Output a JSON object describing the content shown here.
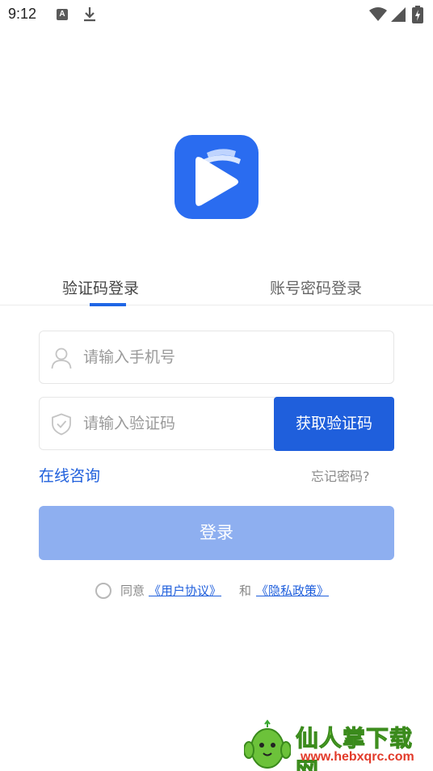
{
  "status_bar": {
    "time": "9:12",
    "notification_letter": "A"
  },
  "app": {
    "logo_icon": "play-logo-icon",
    "brand_color": "#2a6cf0"
  },
  "tabs": [
    {
      "label": "验证码登录",
      "active": true
    },
    {
      "label": "账号密码登录",
      "active": false
    }
  ],
  "form": {
    "phone_placeholder": "请输入手机号",
    "code_placeholder": "请输入验证码",
    "get_code_label": "获取验证码",
    "consult_label": "在线咨询",
    "forgot_label": "忘记密码?",
    "login_label": "登录"
  },
  "agreement": {
    "prefix": "同意",
    "user_agreement": "《用户协议》",
    "and": "和",
    "privacy_policy": "《隐私政策》",
    "checked": false
  },
  "watermark": {
    "title": "仙人掌下载网",
    "url": "www.hebxqrc.com"
  },
  "colors": {
    "accent": "#1f5fdc",
    "login_disabled": "#8eaff0",
    "watermark_green": "#6cc23a",
    "watermark_red": "#e23a2a"
  }
}
